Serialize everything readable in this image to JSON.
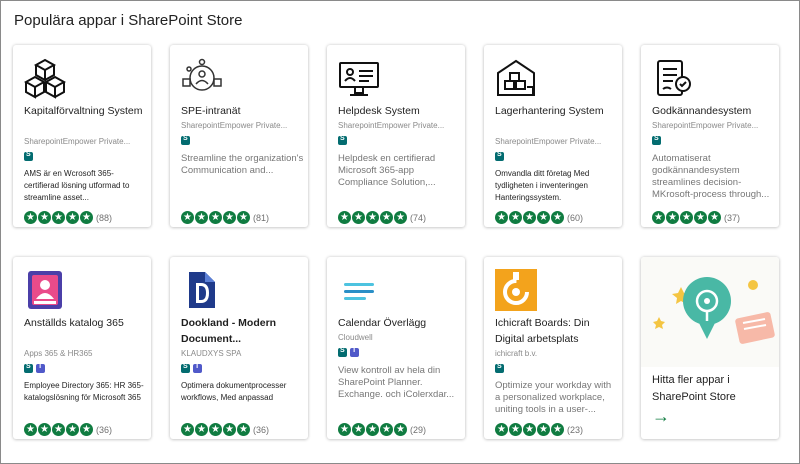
{
  "page_title": "Populära appar i SharePoint Store",
  "colors": {
    "rating": "#107c41",
    "sharepoint": "#036c70",
    "teams": "#5059c9"
  },
  "cards": [
    {
      "name": "Kapitalförvaltning System",
      "publisher": "SharepointEmpower Private...",
      "badges": [
        "sharepoint"
      ],
      "description": "AMS är en Wcrosoft 365-certifierad lösning utformad to streamline asset...",
      "rating_count": "(88)",
      "icon": "cubes-icon"
    },
    {
      "name": "SPE-intranät",
      "publisher": "SharepointEmpower Private...",
      "badges": [
        "sharepoint"
      ],
      "description": "Streamline the organization's Communication and...",
      "rating_count": "(81)",
      "icon": "people-network-icon"
    },
    {
      "name": "Helpdesk System",
      "publisher": "SharepointEmpower Private...",
      "badges": [
        "sharepoint"
      ],
      "description": "Helpdesk en certifierad Microsoft 365-app Compliance Solution,...",
      "rating_count": "(74)",
      "icon": "helpdesk-monitor-icon"
    },
    {
      "name": "Lagerhantering System",
      "publisher": "SharepointEmpower Private...",
      "badges": [
        "sharepoint"
      ],
      "description": "Omvandla ditt företag Med tydligheten i inventeringen Hanteringssystem.",
      "rating_count": "(60)",
      "icon": "warehouse-boxes-icon"
    },
    {
      "name": "Godkännandesystem",
      "publisher": "SharepointEmpower Private...",
      "badges": [
        "sharepoint"
      ],
      "description": "Automatiserat godkännandesystem streamlines decision-MKrosoft-process through...",
      "rating_count": "(37)",
      "icon": "approval-document-icon"
    },
    {
      "name": "Anställds katalog 365",
      "publisher": "Apps 365 & HR365",
      "badges": [
        "sharepoint",
        "teams"
      ],
      "description": "Employee Directory 365: HR 365-katalogslösning för Microsoft 365",
      "rating_count": "(36)",
      "icon": "employee-directory-icon"
    },
    {
      "name": "Dookland - Modern Document...",
      "publisher": "KLAUDXYS SPA",
      "badges": [
        "sharepoint",
        "teams"
      ],
      "description": "Optimera dokumentprocesser workflows, Med anpassad",
      "rating_count": "(36)",
      "icon": "dookland-logo-icon"
    },
    {
      "name": "Calendar Överlägg",
      "publisher": "Cloudwell",
      "badges": [
        "sharepoint",
        "teams"
      ],
      "description": "View kontroll av hela din SharePoint Planner. Exchange. och iColerxdar...",
      "rating_count": "(29)",
      "icon": "calendar-lines-icon"
    },
    {
      "name": "Ichicraft Boards: Din Digital arbetsplats",
      "publisher": "ichicraft b.v.",
      "badges": [
        "sharepoint"
      ],
      "description": "Optimize your workday with a personalized workplace, uniting tools in a user-...",
      "rating_count": "(23)",
      "icon": "ichicraft-logo-icon"
    }
  ],
  "promo": {
    "text": "Hitta fler appar i SharePoint Store",
    "arrow": "→"
  }
}
